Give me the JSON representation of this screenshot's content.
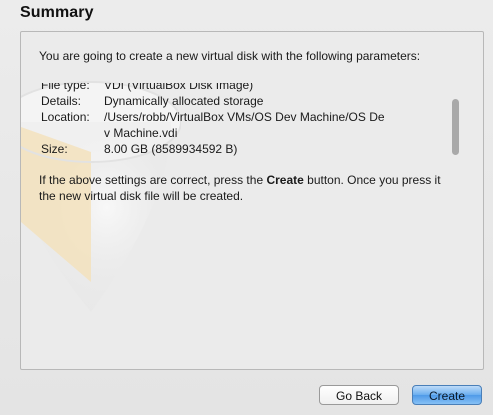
{
  "title": "Summary",
  "intro_text": "You are going to create a new virtual disk with the following parameters:",
  "parameters": [
    {
      "key": "File type:",
      "value": "VDI (VirtualBox Disk Image)"
    },
    {
      "key": "Details:",
      "value": "Dynamically allocated storage"
    },
    {
      "key": "Location:",
      "value": "/Users/robb/VirtualBox VMs/OS Dev Machine/OS De"
    },
    {
      "key": "",
      "value": "v Machine.vdi"
    },
    {
      "key": "Size:",
      "value": "8.00 GB (8589934592 B)"
    }
  ],
  "outro": {
    "part1": "If the above settings are correct, press the ",
    "bold": "Create",
    "part2": " button. Once you press it the new virtual disk file will be created."
  },
  "buttons": {
    "back": "Go Back",
    "create": "Create"
  },
  "colors": {
    "accent": "#6aaeef",
    "panel": "#ebebeb",
    "watermark": "#f3e2bd"
  }
}
